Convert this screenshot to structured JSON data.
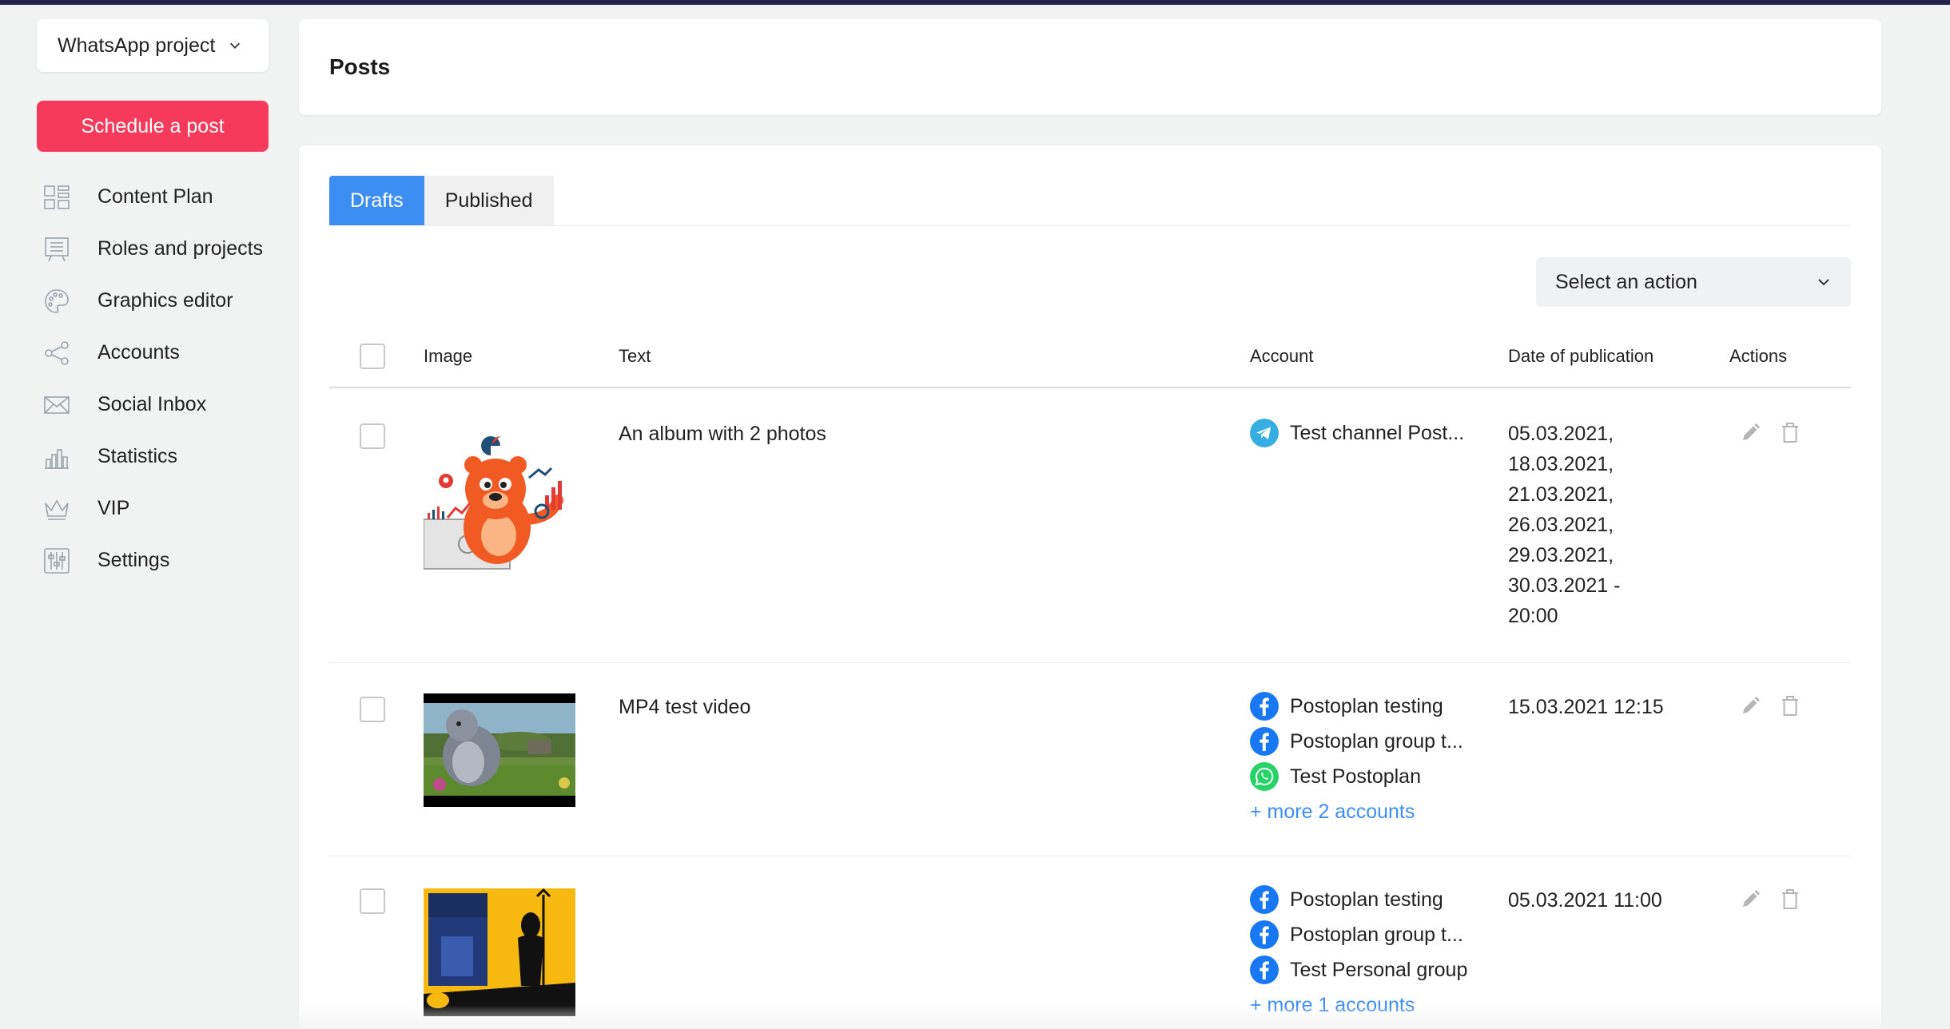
{
  "sidebar": {
    "project_name": "WhatsApp project",
    "schedule_label": "Schedule a post",
    "items": [
      {
        "label": "Content Plan",
        "icon": "grid-icon"
      },
      {
        "label": "Roles and projects",
        "icon": "board-icon"
      },
      {
        "label": "Graphics editor",
        "icon": "palette-icon"
      },
      {
        "label": "Accounts",
        "icon": "share-icon"
      },
      {
        "label": "Social Inbox",
        "icon": "envelope-icon"
      },
      {
        "label": "Statistics",
        "icon": "bar-chart-icon"
      },
      {
        "label": "VIP",
        "icon": "crown-icon"
      },
      {
        "label": "Settings",
        "icon": "sliders-icon"
      }
    ]
  },
  "header": {
    "title": "Posts"
  },
  "tabs": [
    {
      "label": "Drafts",
      "active": true
    },
    {
      "label": "Published",
      "active": false
    }
  ],
  "action_select": {
    "label": "Select an action"
  },
  "table": {
    "columns": {
      "image": "Image",
      "text": "Text",
      "account": "Account",
      "date": "Date of publication",
      "actions": "Actions"
    },
    "rows": [
      {
        "image": "bear-mascot-illustration",
        "text": "An album with 2 photos",
        "accounts": [
          {
            "name": "Test channel Post...",
            "network": "telegram"
          }
        ],
        "more": "",
        "dates": [
          "05.03.2021,",
          "18.03.2021,",
          "21.03.2021,",
          "26.03.2021,",
          "29.03.2021,",
          "30.03.2021 -",
          "20:00"
        ]
      },
      {
        "image": "video-still-bear",
        "text": "MP4 test video",
        "accounts": [
          {
            "name": "Postoplan testing",
            "network": "facebook"
          },
          {
            "name": "Postoplan group t...",
            "network": "facebook"
          },
          {
            "name": "Test Postoplan",
            "network": "whatsapp"
          }
        ],
        "more": "+ more 2 accounts",
        "dates": [
          "15.03.2021 12:15"
        ]
      },
      {
        "image": "yellow-poster",
        "text": "",
        "accounts": [
          {
            "name": "Postoplan testing",
            "network": "facebook"
          },
          {
            "name": "Postoplan group t...",
            "network": "facebook"
          },
          {
            "name": "Test Personal group",
            "network": "facebook"
          }
        ],
        "more": "+ more 1 accounts",
        "dates": [
          "05.03.2021 11:00"
        ]
      }
    ]
  },
  "colors": {
    "accent": "#3d8ef2",
    "schedule_button": "#f53a5b",
    "telegram": "#37aee2",
    "facebook": "#1877f2",
    "whatsapp": "#25d366"
  }
}
